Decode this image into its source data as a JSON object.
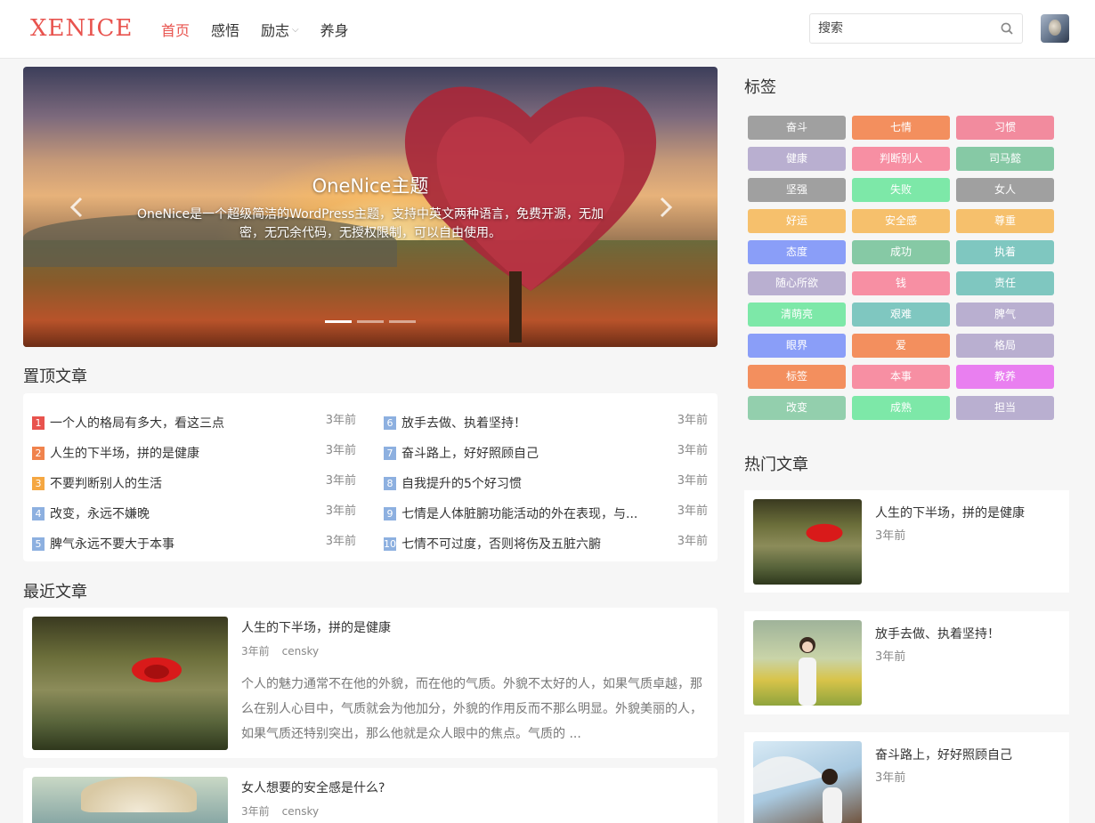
{
  "header": {
    "logo": "XENICE",
    "nav": [
      {
        "label": "首页",
        "active": true
      },
      {
        "label": "感悟",
        "active": false
      },
      {
        "label": "励志",
        "active": false,
        "has_dropdown": true
      },
      {
        "label": "养身",
        "active": false
      }
    ],
    "search_placeholder": "搜索"
  },
  "slider": {
    "title": "OneNice主题",
    "description": "OneNice是一个超级简洁的WordPress主题，支持中英文两种语言，免费开源，无加密，无冗余代码，无授权限制，可以自由使用。",
    "slide_count": 3,
    "active_slide": 1
  },
  "pinned": {
    "title": "置顶文章",
    "items": [
      {
        "num": "1",
        "title": "一个人的格局有多大，看这三点",
        "time": "3年前",
        "color": "#e8534e"
      },
      {
        "num": "2",
        "title": "人生的下半场，拼的是健康",
        "time": "3年前",
        "color": "#f0834d"
      },
      {
        "num": "3",
        "title": "不要判断别人的生活",
        "time": "3年前",
        "color": "#f5a742"
      },
      {
        "num": "4",
        "title": "改变，永远不嫌晚",
        "time": "3年前",
        "color": "#8db0e0"
      },
      {
        "num": "5",
        "title": "脾气永远不要大于本事",
        "time": "3年前",
        "color": "#8db0e0"
      },
      {
        "num": "6",
        "title": "放手去做、执着坚持！",
        "time": "3年前",
        "color": "#8db0e0"
      },
      {
        "num": "7",
        "title": "奋斗路上，好好照顾自己",
        "time": "3年前",
        "color": "#8db0e0"
      },
      {
        "num": "8",
        "title": "自我提升的5个好习惯",
        "time": "3年前",
        "color": "#8db0e0"
      },
      {
        "num": "9",
        "title": "七情是人体脏腑功能活动的外在表现，与...",
        "time": "3年前",
        "color": "#8db0e0"
      },
      {
        "num": "10",
        "title": "七情不可过度，否则将伤及五脏六腑",
        "time": "3年前",
        "color": "#8db0e0"
      }
    ]
  },
  "recent": {
    "title": "最近文章",
    "posts": [
      {
        "title": "人生的下半场，拼的是健康",
        "time": "3年前",
        "author": "censky",
        "excerpt": "个人的魅力通常不在他的外貌，而在他的气质。外貌不太好的人，如果气质卓越，那么在别人心目中，气质就会为他加分，外貌的作用反而不那么明显。外貌美丽的人，如果气质还特别突出，那么他就是众人眼中的焦点。气质的 ..."
      },
      {
        "title": "女人想要的安全感是什么?",
        "time": "3年前",
        "author": "censky"
      }
    ]
  },
  "sidebar": {
    "tags_title": "标签",
    "tags": [
      {
        "label": "奋斗",
        "color": "#a0a0a0"
      },
      {
        "label": "七情",
        "color": "#f38f5e"
      },
      {
        "label": "习惯",
        "color": "#f28b9e"
      },
      {
        "label": "健康",
        "color": "#b9afd0"
      },
      {
        "label": "判断别人",
        "color": "#f78fa3"
      },
      {
        "label": "司马懿",
        "color": "#86c9a5"
      },
      {
        "label": "坚强",
        "color": "#a0a0a0"
      },
      {
        "label": "失败",
        "color": "#7de8a8"
      },
      {
        "label": "女人",
        "color": "#a0a0a0"
      },
      {
        "label": "好运",
        "color": "#f6c06c"
      },
      {
        "label": "安全感",
        "color": "#f6c06c"
      },
      {
        "label": "尊重",
        "color": "#f6c06c"
      },
      {
        "label": "态度",
        "color": "#8a9ef8"
      },
      {
        "label": "成功",
        "color": "#86c9a5"
      },
      {
        "label": "执着",
        "color": "#7fc7c0"
      },
      {
        "label": "随心所欲",
        "color": "#b9afd0"
      },
      {
        "label": "钱",
        "color": "#f78fa3"
      },
      {
        "label": "责任",
        "color": "#7fc7c0"
      },
      {
        "label": "清萌亮",
        "color": "#7de8a8"
      },
      {
        "label": "艰难",
        "color": "#7fc7c0"
      },
      {
        "label": "脾气",
        "color": "#b9afd0"
      },
      {
        "label": "眼界",
        "color": "#8a9ef8"
      },
      {
        "label": "爱",
        "color": "#f38f5e"
      },
      {
        "label": "格局",
        "color": "#b9afd0"
      },
      {
        "label": "标签",
        "color": "#f38f5e"
      },
      {
        "label": "本事",
        "color": "#f78fa3"
      },
      {
        "label": "教养",
        "color": "#e97ff0"
      },
      {
        "label": "改变",
        "color": "#93cfad"
      },
      {
        "label": "成熟",
        "color": "#7de8a8"
      },
      {
        "label": "担当",
        "color": "#b9afd0"
      }
    ],
    "hot_title": "热门文章",
    "hot": [
      {
        "title": "人生的下半场，拼的是健康",
        "time": "3年前"
      },
      {
        "title": "放手去做、执着坚持！",
        "time": "3年前"
      },
      {
        "title": "奋斗路上，好好照顾自己",
        "time": "3年前"
      }
    ]
  }
}
